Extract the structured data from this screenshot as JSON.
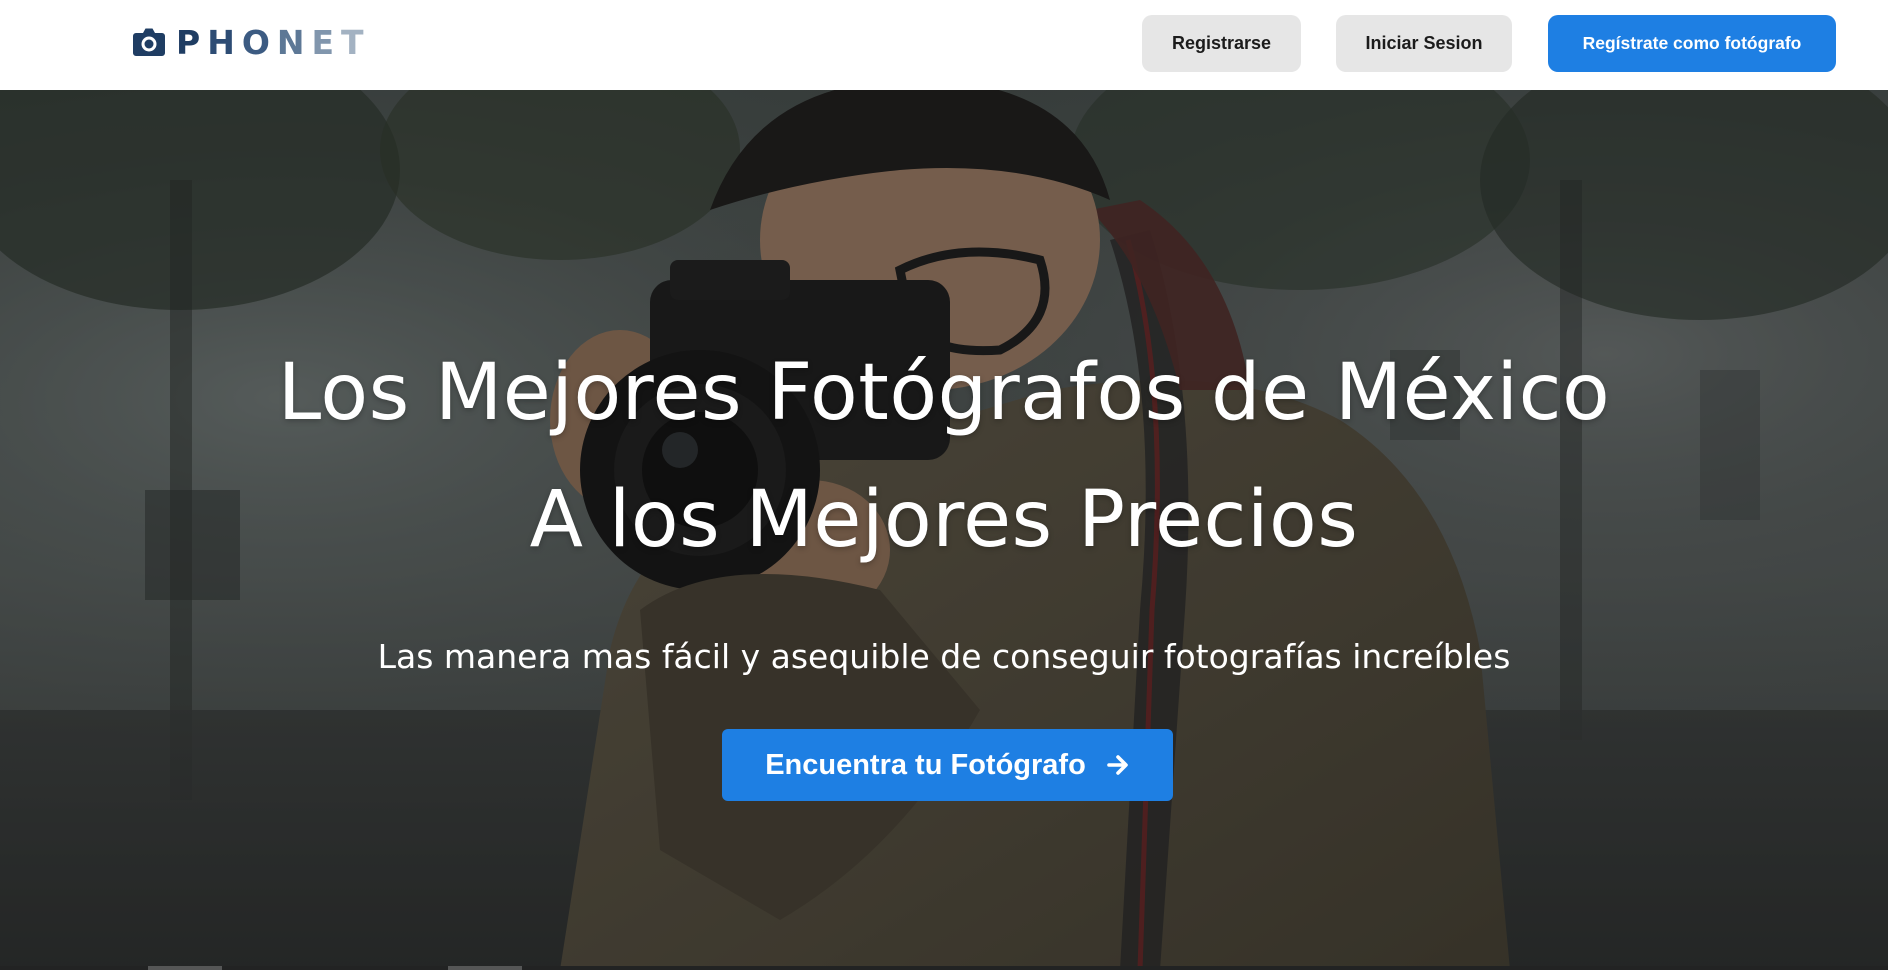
{
  "header": {
    "logo_text": "PHONET",
    "logo_icon": "camera-icon",
    "buttons": {
      "register": "Registrarse",
      "login": "Iniciar Sesion",
      "photographer": "Regístrate como fotógrafo"
    }
  },
  "hero": {
    "title_line_1": "Los Mejores Fotógrafos de México",
    "title_line_2": "A los Mejores Precios",
    "subtitle": "Las manera mas fácil y asequible de conseguir fotografías increíbles",
    "cta_label": "Encuentra tu Fotógrafo",
    "cta_icon": "arrow-right-icon",
    "background_description_icon": "photographer-photo"
  },
  "colors": {
    "accent": "#1e7fe3",
    "secondary_button": "#e6e6e6",
    "logo_dark": "#1f3d63",
    "logo_light": "#a3b2c2"
  }
}
